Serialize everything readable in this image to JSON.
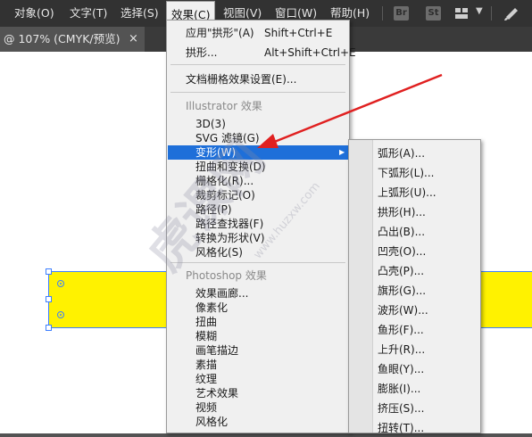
{
  "menubar": {
    "items": [
      "对象(O)",
      "文字(T)",
      "选择(S)",
      "效果(C)",
      "视图(V)",
      "窗口(W)",
      "帮助(H)"
    ],
    "active": "效果(C)",
    "icons": [
      "bridge-icon",
      "stock-icon",
      "workspace-grid-icon",
      "chevron-down-icon",
      "brush-icon"
    ],
    "br_label": "Br",
    "st_label": "St"
  },
  "tab": {
    "title": "@ 107% (CMYK/预览)",
    "close": "×"
  },
  "effect_menu": {
    "apply_last": {
      "label": "应用\"拱形\"(A)",
      "shortcut": "Shift+Ctrl+E"
    },
    "last_effect": {
      "label": "拱形...",
      "shortcut": "Alt+Shift+Ctrl+E"
    },
    "doc_raster": "文档栅格效果设置(E)...",
    "illustrator_heading": "Illustrator 效果",
    "illustrator_items": [
      "3D(3)",
      "SVG 滤镜(G)",
      "变形(W)",
      "扭曲和变换(D)",
      "栅格化(R)...",
      "裁剪标记(O)",
      "路径(P)",
      "路径查找器(F)",
      "转换为形状(V)",
      "风格化(S)"
    ],
    "highlighted": "变形(W)",
    "photoshop_heading": "Photoshop 效果",
    "photoshop_items": [
      "效果画廊...",
      "像素化",
      "扭曲",
      "模糊",
      "画笔描边",
      "素描",
      "纹理",
      "艺术效果",
      "视频",
      "风格化"
    ]
  },
  "warp_submenu": {
    "items": [
      "弧形(A)...",
      "下弧形(L)...",
      "上弧形(U)...",
      "拱形(H)...",
      "凸出(B)...",
      "凹壳(O)...",
      "凸壳(P)...",
      "旗形(G)...",
      "波形(W)...",
      "鱼形(F)...",
      "上升(R)...",
      "鱼眼(Y)...",
      "膨胀(I)...",
      "挤压(S)...",
      "扭转(T)..."
    ]
  },
  "watermark": {
    "text": "虎课网",
    "url": "www.huzxw.com"
  },
  "colors": {
    "menubar_bg": "#323232",
    "menu_bg": "#f0f0f0",
    "highlight": "#1e6fd9",
    "yellow_shape": "#fff200",
    "selection": "#3d7fff",
    "annotation_arrow": "#e02020"
  }
}
